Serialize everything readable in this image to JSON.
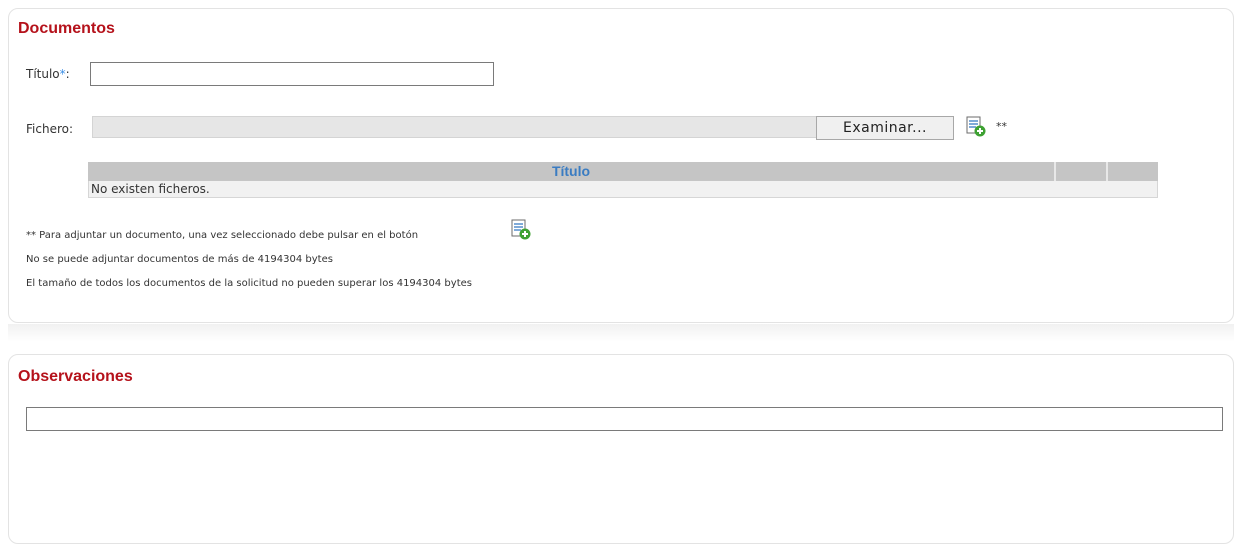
{
  "documentos": {
    "title": "Documentos",
    "titulo_label": "Título",
    "required_mark": "*",
    "label_colon": ":",
    "titulo_value": "",
    "fichero_label": "Fichero:",
    "examinar_label": "Examinar...",
    "add_icon": "add-document-icon",
    "add_note_mark": "**",
    "table": {
      "column_title": "Título",
      "empty_message": "No existen ficheros."
    },
    "notes": {
      "attach_note": "** Para adjuntar un documento, una vez seleccionado debe pulsar en el botón",
      "max_size_note": "No se puede adjuntar documentos de más de 4194304 bytes",
      "total_size_note": "El tamaño de todos los documentos de la solicitud no pueden superar los 4194304 bytes"
    }
  },
  "observaciones": {
    "title": "Observaciones",
    "value": ""
  },
  "colors": {
    "section_title": "#b5121b",
    "required_mark": "#3a8ee6",
    "table_header_text": "#3a7cc2",
    "table_header_bg": "#c5c5c5"
  }
}
